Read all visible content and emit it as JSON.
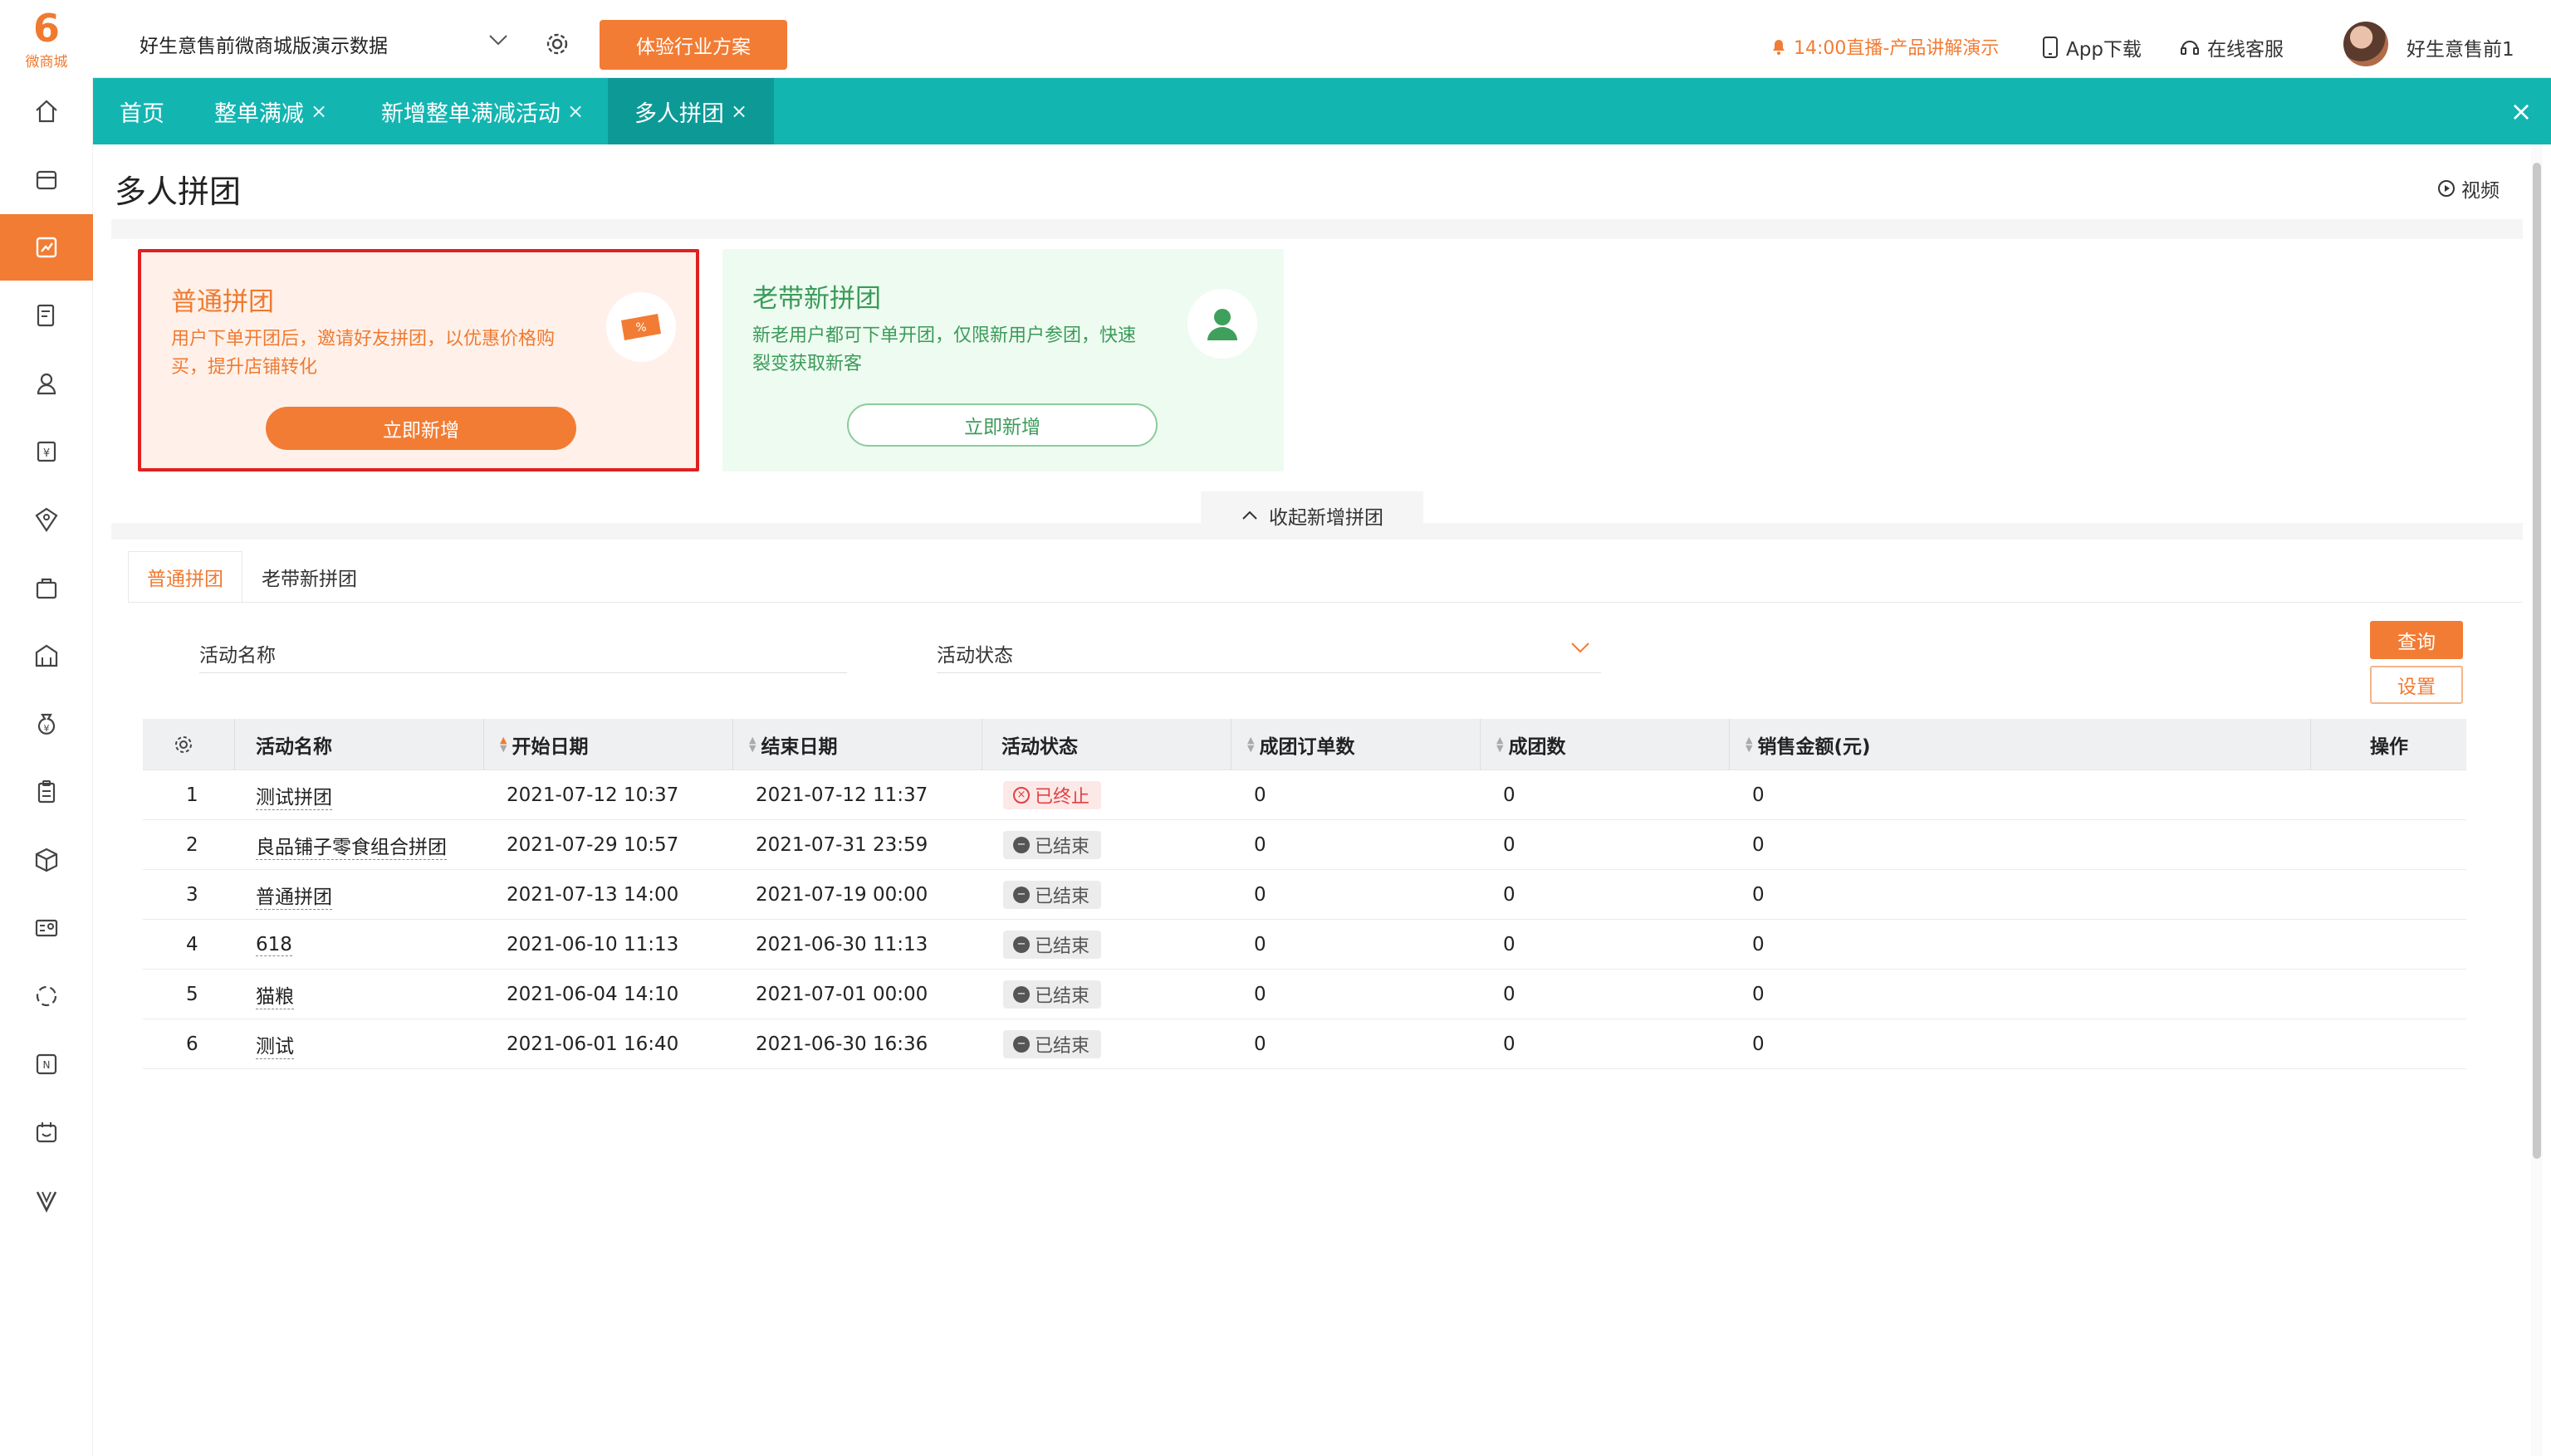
{
  "header": {
    "logo_text": "微商城",
    "shop_name": "好生意售前微商城版演示数据",
    "experience_button": "体验行业方案",
    "live_text": "14:00直播-产品讲解演示",
    "app_download": "App下载",
    "online_service": "在线客服",
    "username": "好生意售前1"
  },
  "sidebar": {
    "items": [
      {
        "icon": "home-icon"
      },
      {
        "icon": "store-icon"
      },
      {
        "icon": "marketing-icon",
        "active": true
      },
      {
        "icon": "order-icon"
      },
      {
        "icon": "member-icon"
      },
      {
        "icon": "finance-icon"
      },
      {
        "icon": "distribution-icon"
      },
      {
        "icon": "goods-bag-icon"
      },
      {
        "icon": "shop-icon"
      },
      {
        "icon": "money-bag-icon"
      },
      {
        "icon": "clipboard-icon"
      },
      {
        "icon": "cube-icon"
      },
      {
        "icon": "card-icon"
      },
      {
        "icon": "cycle-icon"
      },
      {
        "icon": "new-icon"
      },
      {
        "icon": "calendar-icon"
      },
      {
        "icon": "vip-icon"
      }
    ]
  },
  "tabs": [
    {
      "label": "首页",
      "closable": false
    },
    {
      "label": "整单满减",
      "closable": true
    },
    {
      "label": "新增整单满减活动",
      "closable": true
    },
    {
      "label": "多人拼团",
      "closable": true,
      "active": true
    }
  ],
  "page": {
    "title": "多人拼团",
    "video_link": "视频",
    "collapse_label": "收起新增拼团"
  },
  "cards": {
    "normal": {
      "title": "普通拼团",
      "desc": "用户下单开团后，邀请好友拼团，以优惠价格购买，提升店铺转化",
      "button": "立即新增"
    },
    "newbie": {
      "title": "老带新拼团",
      "desc": "新老用户都可下单开团，仅限新用户参团，快速裂变获取新客",
      "button": "立即新增"
    }
  },
  "list_tabs": [
    "普通拼团",
    "老带新拼团"
  ],
  "filters": {
    "name_label": "活动名称",
    "status_label": "活动状态",
    "query_button": "查询",
    "settings_button": "设置"
  },
  "table": {
    "headers": {
      "name": "活动名称",
      "start": "开始日期",
      "end": "结束日期",
      "status": "活动状态",
      "orders": "成团订单数",
      "groups": "成团数",
      "sales": "销售金额(元)",
      "ops": "操作"
    },
    "rows": [
      {
        "idx": "1",
        "name": "测试拼团",
        "start": "2021-07-12 10:37",
        "end": "2021-07-12 11:37",
        "status": "已终止",
        "status_type": "stopped",
        "orders": "0",
        "groups": "0",
        "sales": "0"
      },
      {
        "idx": "2",
        "name": "良品铺子零食组合拼团",
        "start": "2021-07-29 10:57",
        "end": "2021-07-31 23:59",
        "status": "已结束",
        "status_type": "ended",
        "orders": "0",
        "groups": "0",
        "sales": "0"
      },
      {
        "idx": "3",
        "name": "普通拼团",
        "start": "2021-07-13 14:00",
        "end": "2021-07-19 00:00",
        "status": "已结束",
        "status_type": "ended",
        "orders": "0",
        "groups": "0",
        "sales": "0"
      },
      {
        "idx": "4",
        "name": "618",
        "start": "2021-06-10 11:13",
        "end": "2021-06-30 11:13",
        "status": "已结束",
        "status_type": "ended",
        "orders": "0",
        "groups": "0",
        "sales": "0"
      },
      {
        "idx": "5",
        "name": "猫粮",
        "start": "2021-06-04 14:10",
        "end": "2021-07-01 00:00",
        "status": "已结束",
        "status_type": "ended",
        "orders": "0",
        "groups": "0",
        "sales": "0"
      },
      {
        "idx": "6",
        "name": "测试",
        "start": "2021-06-01 16:40",
        "end": "2021-06-30 16:36",
        "status": "已结束",
        "status_type": "ended",
        "orders": "0",
        "groups": "0",
        "sales": "0"
      }
    ]
  },
  "colors": {
    "brand_orange": "#f27c34",
    "tab_teal": "#13b5b1",
    "highlight_red": "#e02020",
    "green_text": "#3b9b5a"
  }
}
